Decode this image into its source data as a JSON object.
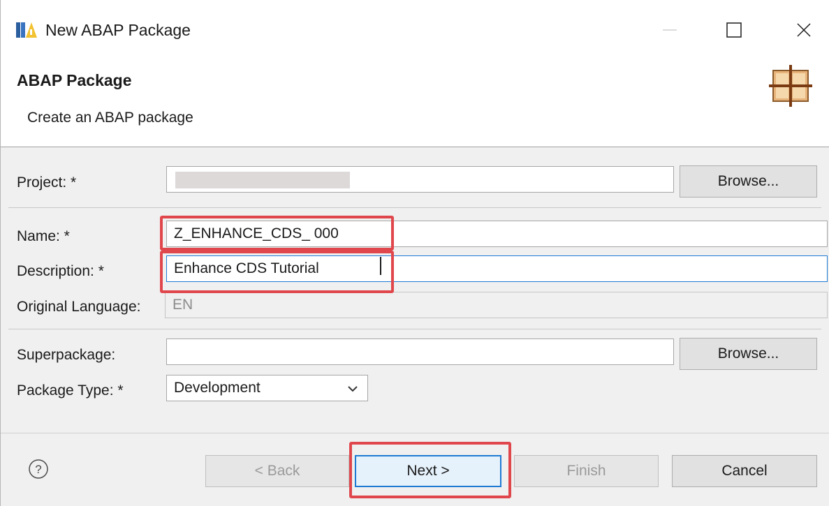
{
  "window": {
    "title": "New ABAP Package",
    "minimize_label": "—",
    "maximize_icon": "maximize-icon",
    "close_icon": "close-icon"
  },
  "banner": {
    "title": "ABAP Package",
    "description": "Create an ABAP package",
    "icon": "package-icon"
  },
  "form": {
    "project_label": "Project: *",
    "project_value": "",
    "project_browse": "Browse...",
    "name_label": "Name: *",
    "name_value": "Z_ENHANCE_CDS_ 000",
    "description_label": "Description: *",
    "description_value": "Enhance CDS Tutorial",
    "language_label": "Original Language:",
    "language_value": "EN",
    "superpackage_label": "Superpackage:",
    "superpackage_value": "",
    "superpackage_browse": "Browse...",
    "package_type_label": "Package Type: *",
    "package_type_value": "Development"
  },
  "footer": {
    "help_icon": "help-icon",
    "back_label": "< Back",
    "next_label": "Next >",
    "finish_label": "Finish",
    "cancel_label": "Cancel"
  },
  "colors": {
    "highlight": "#e0474c",
    "focus": "#1f7ad4"
  }
}
